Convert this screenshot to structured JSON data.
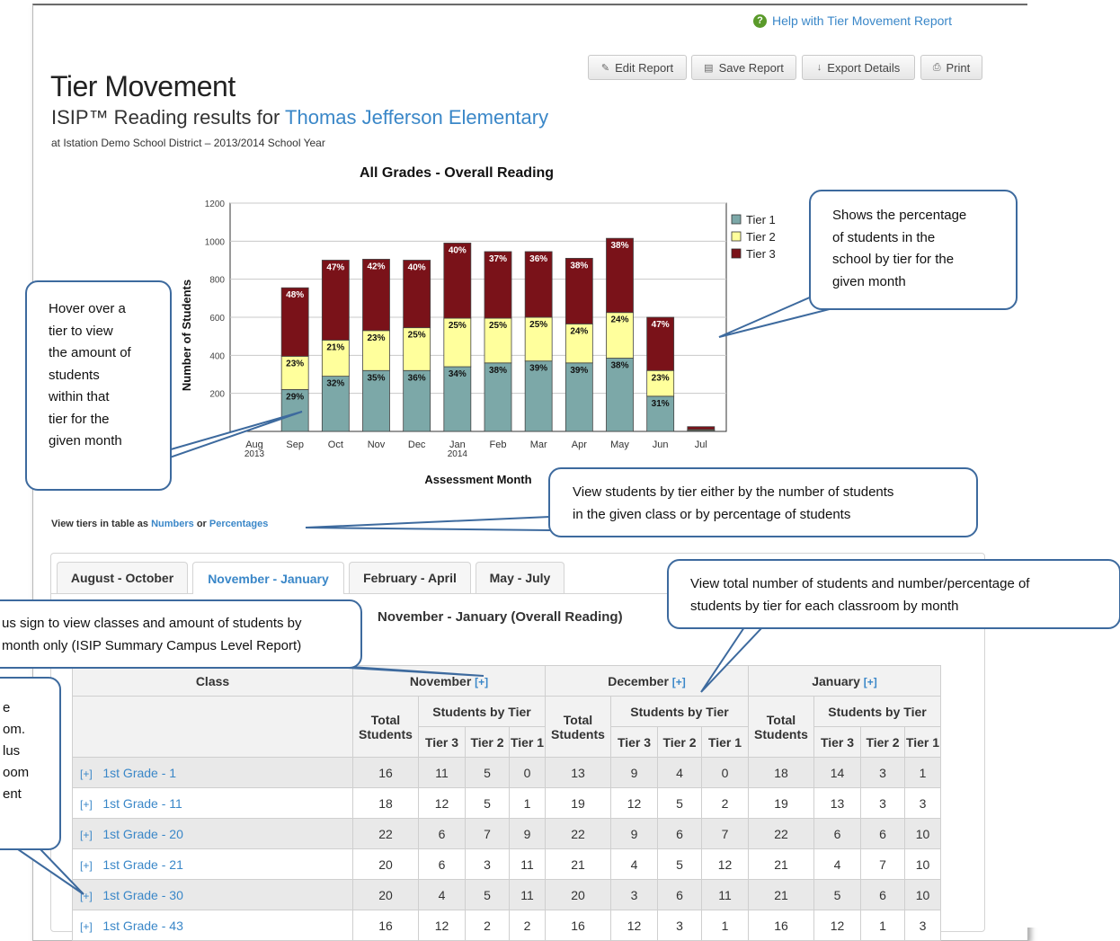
{
  "help_link": "Help with Tier Movement Report",
  "toolbar": {
    "edit": "Edit Report",
    "save": "Save Report",
    "export": "Export Details",
    "print": "Print"
  },
  "header": {
    "title": "Tier Movement",
    "subtitle_prefix": "ISIP™ Reading results for ",
    "school": "Thomas Jefferson Elementary",
    "district_line": "at Istation Demo School District – 2013/2014 School Year"
  },
  "chart_data": {
    "type": "bar",
    "stacked": true,
    "title": "All Grades - Overall Reading",
    "xlabel": "Assessment Month",
    "ylabel": "Number of Students",
    "ylim": [
      0,
      1200
    ],
    "yticks": [
      200,
      400,
      600,
      800,
      1000,
      1200
    ],
    "categories": [
      "Aug 2013",
      "Sep",
      "Oct",
      "Nov",
      "Dec",
      "Jan 2014",
      "Feb",
      "Mar",
      "Apr",
      "May",
      "Jun",
      "Jul"
    ],
    "series": [
      {
        "name": "Tier 1",
        "color": "#7ca8a8",
        "values": [
          0,
          220,
          290,
          320,
          320,
          340,
          360,
          370,
          360,
          385,
          185,
          5
        ],
        "labels": [
          "",
          "29%",
          "32%",
          "35%",
          "36%",
          "34%",
          "38%",
          "39%",
          "39%",
          "38%",
          "31%",
          ""
        ]
      },
      {
        "name": "Tier 2",
        "color": "#ffff9c",
        "values": [
          0,
          175,
          190,
          210,
          225,
          255,
          235,
          230,
          205,
          240,
          135,
          5
        ],
        "labels": [
          "",
          "23%",
          "21%",
          "23%",
          "25%",
          "25%",
          "25%",
          "25%",
          "24%",
          "24%",
          "23%",
          ""
        ]
      },
      {
        "name": "Tier 3",
        "color": "#7a1219",
        "values": [
          0,
          360,
          420,
          375,
          355,
          395,
          350,
          345,
          345,
          390,
          280,
          15
        ],
        "labels": [
          "",
          "48%",
          "47%",
          "42%",
          "40%",
          "40%",
          "37%",
          "36%",
          "38%",
          "38%",
          "47%",
          ""
        ]
      }
    ],
    "legend_position": "right"
  },
  "view_tiers": {
    "prefix": "View tiers in table as ",
    "numbers": "Numbers",
    "or": " or ",
    "percentages": "Percentages"
  },
  "tabs": [
    "August - October",
    "November - January",
    "February - April",
    "May - July"
  ],
  "active_tab": "November - January",
  "section_title": "November - January (Overall Reading)",
  "table": {
    "class_header": "Class",
    "months": [
      "November",
      "December",
      "January"
    ],
    "expand": "[+]",
    "total_header_1": "Total",
    "total_header_2": "Students",
    "by_tier_header": "Students by Tier",
    "tier_headers": [
      "Tier 3",
      "Tier 2",
      "Tier 1"
    ],
    "rows": [
      {
        "name": "1st Grade - 1",
        "values": [
          "16",
          "11",
          "5",
          "0",
          "13",
          "9",
          "4",
          "0",
          "18",
          "14",
          "3",
          "1"
        ]
      },
      {
        "name": "1st Grade - 11",
        "values": [
          "18",
          "12",
          "5",
          "1",
          "19",
          "12",
          "5",
          "2",
          "19",
          "13",
          "3",
          "3"
        ]
      },
      {
        "name": "1st Grade - 20",
        "values": [
          "22",
          "6",
          "7",
          "9",
          "22",
          "9",
          "6",
          "7",
          "22",
          "6",
          "6",
          "10"
        ]
      },
      {
        "name": "1st Grade - 21",
        "values": [
          "20",
          "6",
          "3",
          "11",
          "21",
          "4",
          "5",
          "12",
          "21",
          "4",
          "7",
          "10"
        ]
      },
      {
        "name": "1st Grade - 30",
        "values": [
          "20",
          "4",
          "5",
          "11",
          "20",
          "3",
          "6",
          "11",
          "21",
          "5",
          "6",
          "10"
        ]
      },
      {
        "name": "1st Grade - 43",
        "values": [
          "16",
          "12",
          "2",
          "2",
          "16",
          "12",
          "3",
          "1",
          "16",
          "12",
          "1",
          "3"
        ]
      }
    ]
  },
  "callouts": {
    "hover": [
      "Hover over a",
      "tier to view",
      "the amount of",
      "students",
      "within that",
      "tier for the",
      "given month"
    ],
    "percentage": [
      "Shows the percentage",
      "of students in the",
      "school by tier for the",
      "given month"
    ],
    "view_by": [
      "View students by tier either by the number of students",
      "in the given class or by percentage of students"
    ],
    "total_by_month": [
      "View total number of students and number/percentage of",
      "students by tier for each classroom by month"
    ],
    "plus_sign": [
      "us sign to view classes and amount of students by",
      "month only (ISIP Summary Campus Level Report)"
    ],
    "left_partial": [
      "e",
      "om.",
      "lus",
      "oom",
      "ent"
    ]
  }
}
